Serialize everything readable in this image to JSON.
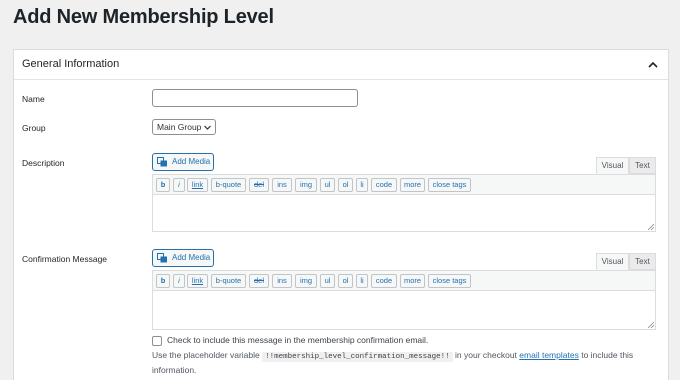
{
  "page": {
    "title": "Add New Membership Level"
  },
  "panel": {
    "title": "General Information",
    "toggle_icon": "chevron-up-icon"
  },
  "fields": {
    "name": {
      "label": "Name",
      "value": "",
      "placeholder": ""
    },
    "group": {
      "label": "Group",
      "selected": "Main Group"
    },
    "description": {
      "label": "Description"
    },
    "confirmation": {
      "label": "Confirmation Message"
    }
  },
  "editor": {
    "add_media": "Add Media",
    "media_icon": "media-icon",
    "tabs": {
      "visual": "Visual",
      "text": "Text"
    },
    "buttons": [
      "b",
      "i",
      "link",
      "b-quote",
      "del",
      "ins",
      "img",
      "ul",
      "ol",
      "li",
      "code",
      "more",
      "close tags"
    ]
  },
  "confirmation_email": {
    "checkbox_label": "Check to include this message in the membership confirmation email.",
    "help_prefix": "Use the placeholder variable",
    "help_code": "!!membership_level_confirmation_message!!",
    "help_middle": "in your checkout",
    "help_link": "email templates",
    "help_suffix": "to include this information."
  },
  "colors": {
    "accent": "#2271b1",
    "background": "#f0f0f1",
    "border": "#dcdcde"
  }
}
